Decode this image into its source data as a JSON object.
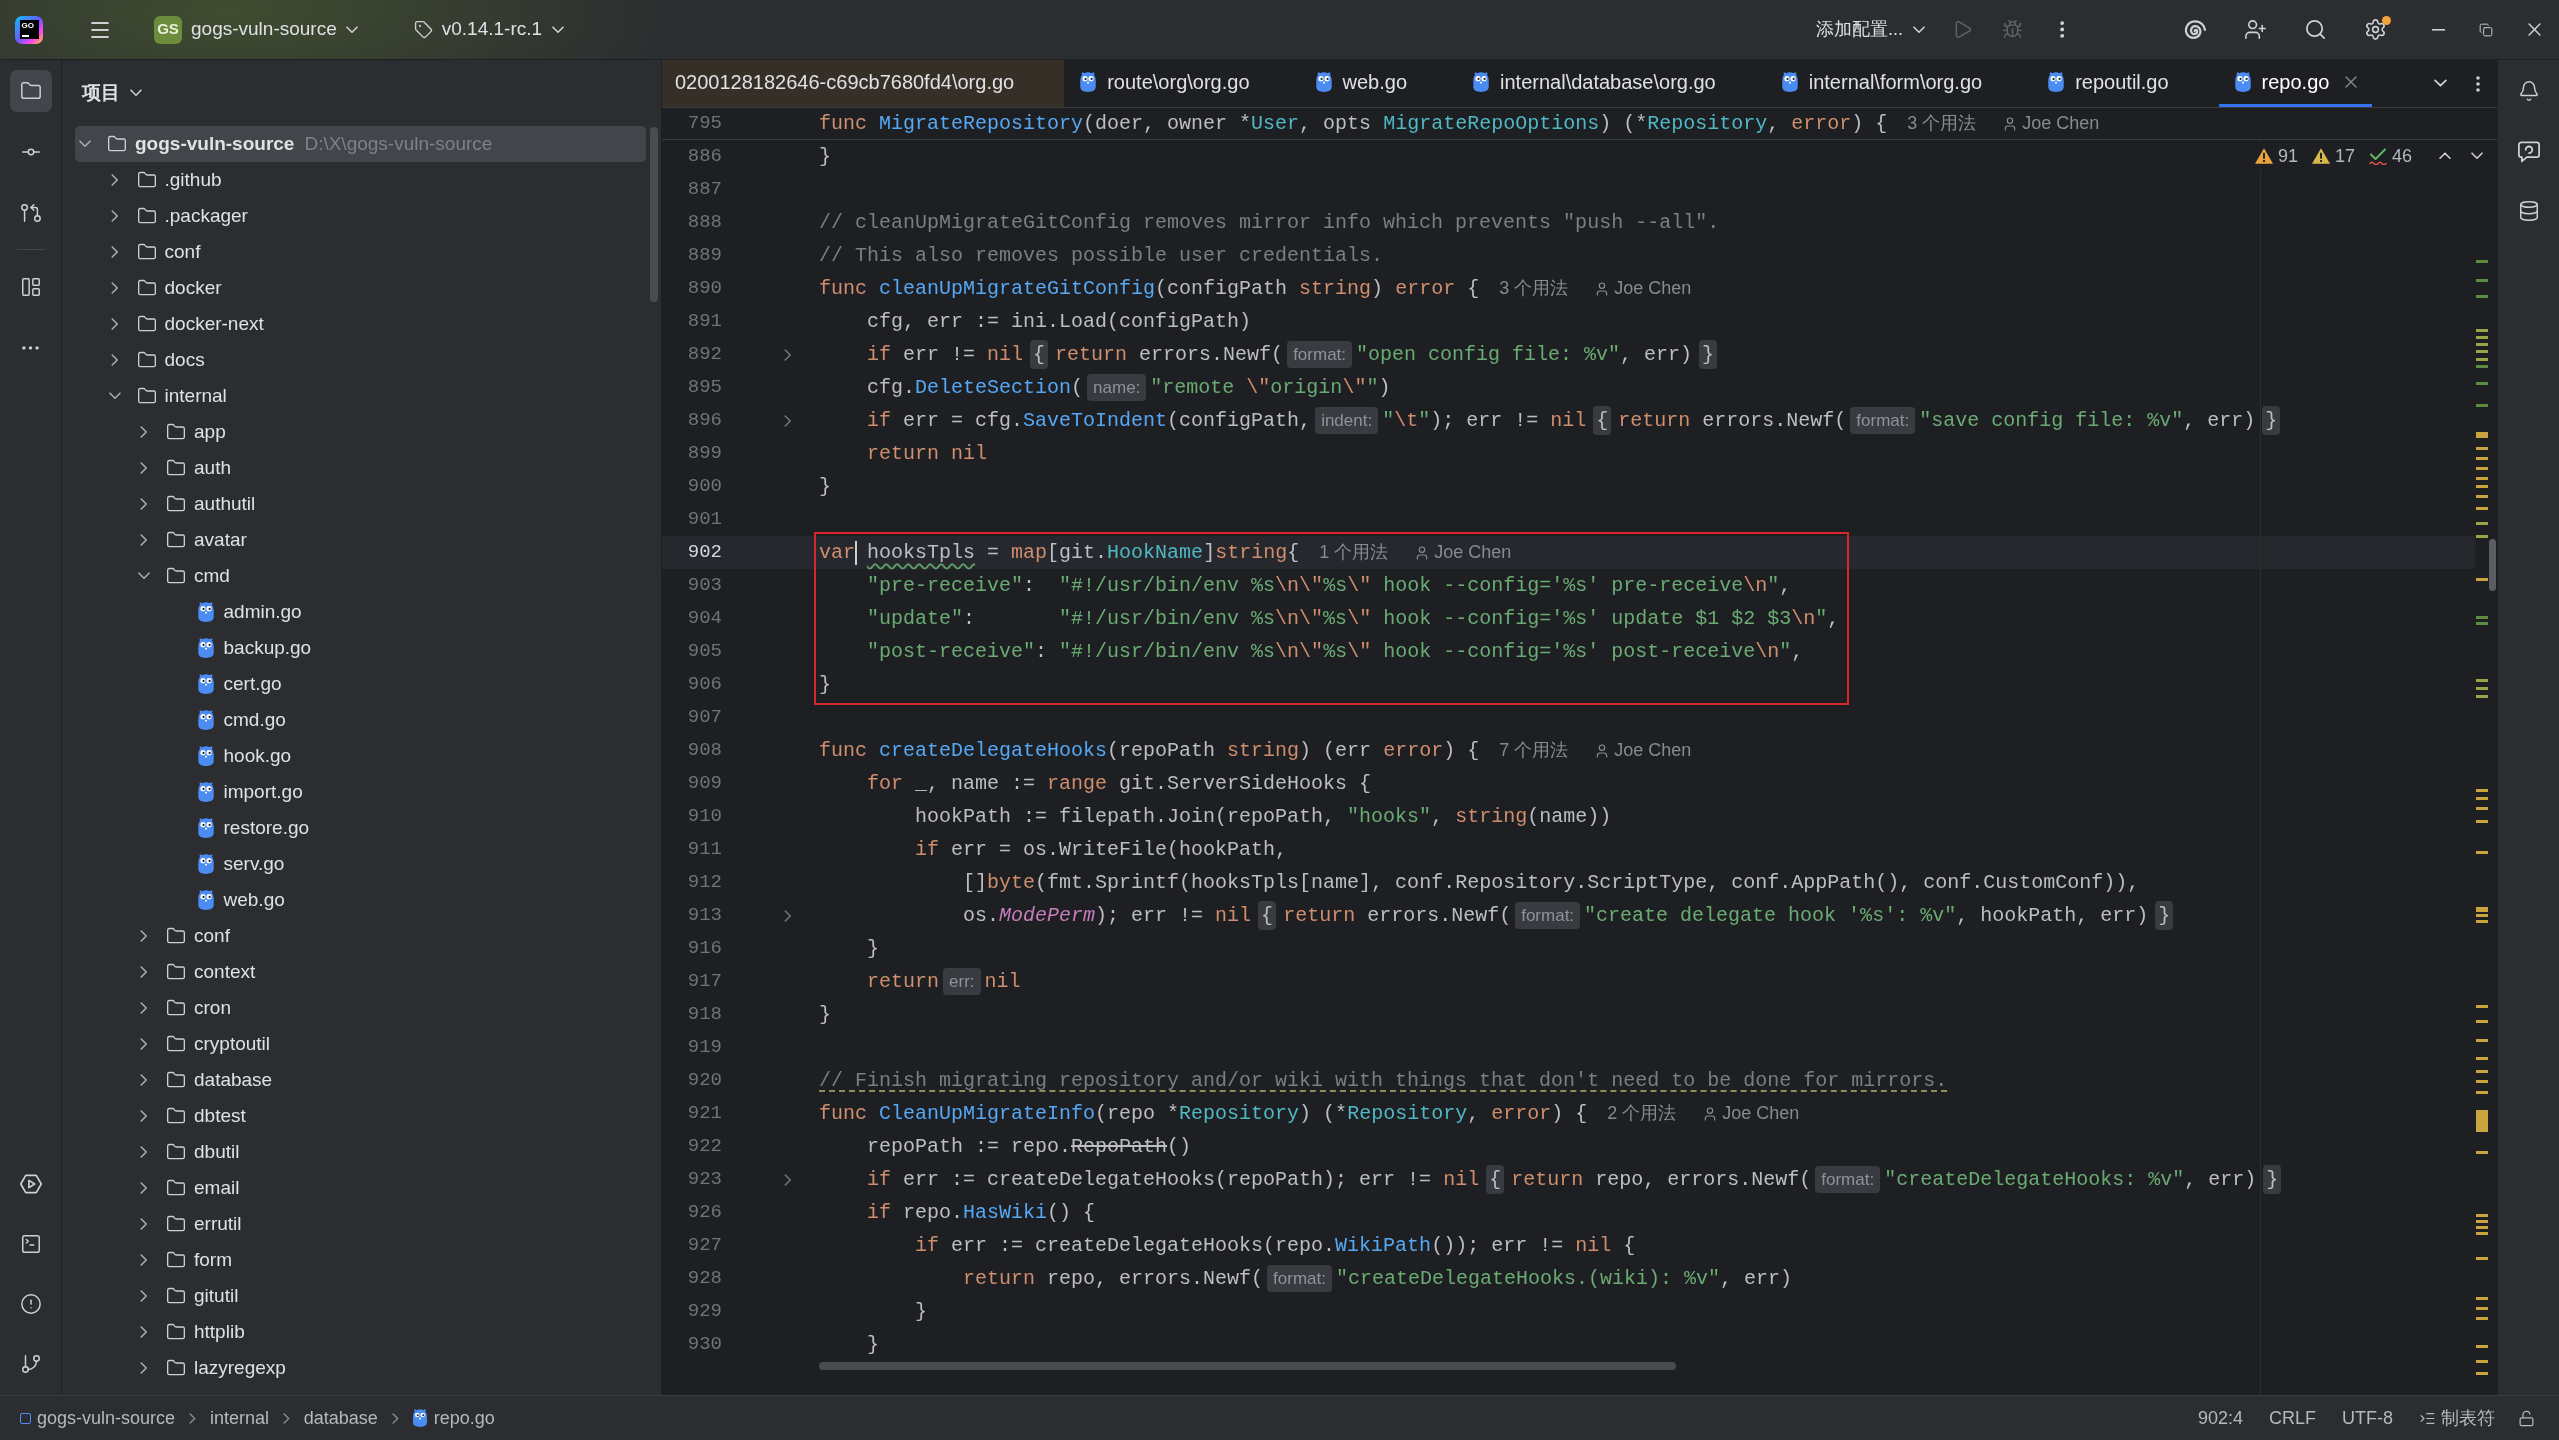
{
  "title_bar": {
    "logo": "GO",
    "project": {
      "initials": "GS",
      "name": "gogs-vuln-source"
    },
    "branch": "v0.14.1-rc.1",
    "run_configuration": "添加配置...",
    "run_actions": [
      {
        "disabled": true
      },
      {
        "disabled": true
      }
    ],
    "settings_badge": true
  },
  "tool_strip": [
    {
      "selected": true
    },
    {
      "selected": false
    },
    {
      "selected": false
    },
    {
      "selected": false
    }
  ],
  "project_panel": {
    "title": "项目",
    "root": {
      "name": "gogs-vuln-source",
      "path": "D:\\X\\gogs-vuln-source",
      "kind": "folder",
      "expanded": true,
      "selected": true,
      "children": [
        {
          "name": ".github",
          "kind": "folder",
          "expanded": false,
          "selected": false
        },
        {
          "name": ".packager",
          "kind": "folder",
          "expanded": false,
          "selected": false
        },
        {
          "name": "conf",
          "kind": "folder",
          "expanded": false,
          "selected": false
        },
        {
          "name": "docker",
          "kind": "folder",
          "expanded": false,
          "selected": false
        },
        {
          "name": "docker-next",
          "kind": "folder",
          "expanded": false,
          "selected": false
        },
        {
          "name": "docs",
          "kind": "folder",
          "expanded": false,
          "selected": false
        },
        {
          "name": "internal",
          "kind": "folder",
          "expanded": true,
          "selected": false,
          "children": [
            {
              "name": "app",
              "kind": "folder",
              "expanded": false,
              "selected": false
            },
            {
              "name": "auth",
              "kind": "folder",
              "expanded": false,
              "selected": false
            },
            {
              "name": "authutil",
              "kind": "folder",
              "expanded": false,
              "selected": false
            },
            {
              "name": "avatar",
              "kind": "folder",
              "expanded": false,
              "selected": false
            },
            {
              "name": "cmd",
              "kind": "folder",
              "expanded": true,
              "selected": false,
              "children": [
                {
                  "name": "admin.go",
                  "kind": "file",
                  "selected": false
                },
                {
                  "name": "backup.go",
                  "kind": "file",
                  "selected": false
                },
                {
                  "name": "cert.go",
                  "kind": "file",
                  "selected": false
                },
                {
                  "name": "cmd.go",
                  "kind": "file",
                  "selected": false
                },
                {
                  "name": "hook.go",
                  "kind": "file",
                  "selected": false
                },
                {
                  "name": "import.go",
                  "kind": "file",
                  "selected": false
                },
                {
                  "name": "restore.go",
                  "kind": "file",
                  "selected": false
                },
                {
                  "name": "serv.go",
                  "kind": "file",
                  "selected": false
                },
                {
                  "name": "web.go",
                  "kind": "file",
                  "selected": false
                }
              ]
            },
            {
              "name": "conf",
              "kind": "folder",
              "expanded": false,
              "selected": false
            },
            {
              "name": "context",
              "kind": "folder",
              "expanded": false,
              "selected": false
            },
            {
              "name": "cron",
              "kind": "folder",
              "expanded": false,
              "selected": false
            },
            {
              "name": "cryptoutil",
              "kind": "folder",
              "expanded": false,
              "selected": false
            },
            {
              "name": "database",
              "kind": "folder",
              "expanded": false,
              "selected": false
            },
            {
              "name": "dbtest",
              "kind": "folder",
              "expanded": false,
              "selected": false
            },
            {
              "name": "dbutil",
              "kind": "folder",
              "expanded": false,
              "selected": false
            },
            {
              "name": "email",
              "kind": "folder",
              "expanded": false,
              "selected": false
            },
            {
              "name": "errutil",
              "kind": "folder",
              "expanded": false,
              "selected": false
            },
            {
              "name": "form",
              "kind": "folder",
              "expanded": false,
              "selected": false
            },
            {
              "name": "gitutil",
              "kind": "folder",
              "expanded": false,
              "selected": false
            },
            {
              "name": "httplib",
              "kind": "folder",
              "expanded": false,
              "selected": false
            },
            {
              "name": "lazyregexp",
              "kind": "folder",
              "expanded": false,
              "selected": false
            }
          ]
        }
      ]
    }
  },
  "tabs": [
    {
      "label": "0200128182646-c69cb7680fd4\\org.go",
      "selected": false,
      "kind": "library",
      "clipped": true
    },
    {
      "label": "route\\org\\org.go",
      "selected": false,
      "kind": "project",
      "clipped": false
    },
    {
      "label": "web.go",
      "selected": false,
      "kind": "project",
      "clipped": false
    },
    {
      "label": "internal\\database\\org.go",
      "selected": false,
      "kind": "project",
      "clipped": false
    },
    {
      "label": "internal\\form\\org.go",
      "selected": false,
      "kind": "project",
      "clipped": false
    },
    {
      "label": "repoutil.go",
      "selected": false,
      "kind": "project",
      "clipped": false
    },
    {
      "label": "repo.go",
      "selected": true,
      "kind": "project",
      "clipped": false
    }
  ],
  "sticky_line": {
    "number": "795",
    "tokens": [
      {
        "kind": "keyword",
        "text": "func "
      },
      {
        "kind": "function",
        "text": "MigrateRepository"
      },
      {
        "kind": "plain",
        "text": "(doer, owner *"
      },
      {
        "kind": "type",
        "text": "User"
      },
      {
        "kind": "plain",
        "text": ", opts "
      },
      {
        "kind": "type",
        "text": "MigrateRepoOptions"
      },
      {
        "kind": "plain",
        "text": ") (*"
      },
      {
        "kind": "type",
        "text": "Repository"
      },
      {
        "kind": "plain",
        "text": ", "
      },
      {
        "kind": "keyword",
        "text": "error"
      },
      {
        "kind": "plain",
        "text": ") {"
      },
      {
        "kind": "usage",
        "text": "3 个用法"
      },
      {
        "kind": "author",
        "text": "Joe Chen"
      }
    ]
  },
  "inspections": [
    {
      "kind": "warning",
      "count": "91"
    },
    {
      "kind": "weak_warning",
      "count": "17"
    },
    {
      "kind": "typo",
      "count": "46"
    }
  ],
  "code_lines": [
    {
      "number": "886",
      "current": false,
      "folded": false,
      "framed": false,
      "tokens": [
        {
          "kind": "plain",
          "text": "}"
        }
      ]
    },
    {
      "number": "887",
      "current": false,
      "folded": false,
      "framed": false
    },
    {
      "number": "888",
      "current": false,
      "folded": false,
      "framed": false,
      "tokens": [
        {
          "kind": "comment",
          "text": "// cleanUpMigrateGitConfig removes mirror info which prevents \"push --all\"."
        }
      ]
    },
    {
      "number": "889",
      "current": false,
      "folded": false,
      "framed": false,
      "tokens": [
        {
          "kind": "comment",
          "text": "// This also removes possible user credentials."
        }
      ]
    },
    {
      "number": "890",
      "current": false,
      "folded": false,
      "framed": false,
      "tokens": [
        {
          "kind": "keyword",
          "text": "func "
        },
        {
          "kind": "function",
          "text": "cleanUpMigrateGitConfig"
        },
        {
          "kind": "plain",
          "text": "(configPath "
        },
        {
          "kind": "keyword",
          "text": "string"
        },
        {
          "kind": "plain",
          "text": ") "
        },
        {
          "kind": "keyword",
          "text": "error"
        },
        {
          "kind": "plain",
          "text": " {"
        },
        {
          "kind": "usage",
          "text": "3 个用法"
        },
        {
          "kind": "author",
          "text": "Joe Chen"
        }
      ]
    },
    {
      "number": "891",
      "current": false,
      "folded": false,
      "framed": false,
      "tokens": [
        {
          "kind": "plain",
          "text": "    cfg, err := ini.Load(configPath)"
        }
      ]
    },
    {
      "number": "892",
      "current": false,
      "folded": true,
      "framed": false,
      "tokens": [
        {
          "kind": "keyword",
          "text": "    if"
        },
        {
          "kind": "plain",
          "text": " err != "
        },
        {
          "kind": "keyword",
          "text": "nil"
        },
        {
          "kind": "fold",
          "text": "{"
        },
        {
          "kind": "keyword",
          "text": "return"
        },
        {
          "kind": "plain",
          "text": " errors.Newf("
        },
        {
          "kind": "hint",
          "text": "format:"
        },
        {
          "kind": "string",
          "text": "\"open config file: %v\""
        },
        {
          "kind": "plain",
          "text": ", err)"
        },
        {
          "kind": "fold",
          "text": "}"
        }
      ]
    },
    {
      "number": "895",
      "current": false,
      "folded": false,
      "framed": false,
      "tokens": [
        {
          "kind": "plain",
          "text": "    cfg."
        },
        {
          "kind": "function",
          "text": "DeleteSection"
        },
        {
          "kind": "plain",
          "text": "("
        },
        {
          "kind": "hint",
          "text": "name:"
        },
        {
          "kind": "string",
          "text": "\"remote "
        },
        {
          "kind": "escape",
          "text": "\\\""
        },
        {
          "kind": "string",
          "text": "origin"
        },
        {
          "kind": "escape",
          "text": "\\\""
        },
        {
          "kind": "string",
          "text": "\""
        },
        {
          "kind": "plain",
          "text": ")"
        }
      ]
    },
    {
      "number": "896",
      "current": false,
      "folded": true,
      "framed": false,
      "tokens": [
        {
          "kind": "keyword",
          "text": "    if"
        },
        {
          "kind": "plain",
          "text": " err = cfg."
        },
        {
          "kind": "function",
          "text": "SaveToIndent"
        },
        {
          "kind": "plain",
          "text": "(configPath,"
        },
        {
          "kind": "hint",
          "text": "indent:"
        },
        {
          "kind": "string",
          "text": "\""
        },
        {
          "kind": "escape",
          "text": "\\t"
        },
        {
          "kind": "string",
          "text": "\""
        },
        {
          "kind": "plain",
          "text": "); err != "
        },
        {
          "kind": "keyword",
          "text": "nil"
        },
        {
          "kind": "fold",
          "text": "{"
        },
        {
          "kind": "keyword",
          "text": "return"
        },
        {
          "kind": "plain",
          "text": " errors.Newf("
        },
        {
          "kind": "hint",
          "text": "format:"
        },
        {
          "kind": "string",
          "text": "\"save config file: %v\""
        },
        {
          "kind": "plain",
          "text": ", err)"
        },
        {
          "kind": "fold",
          "text": "}"
        }
      ]
    },
    {
      "number": "899",
      "current": false,
      "folded": false,
      "framed": false,
      "tokens": [
        {
          "kind": "keyword",
          "text": "    return nil"
        }
      ]
    },
    {
      "number": "900",
      "current": false,
      "folded": false,
      "framed": false,
      "tokens": [
        {
          "kind": "plain",
          "text": "}"
        }
      ]
    },
    {
      "number": "901",
      "current": false,
      "folded": false,
      "framed": false
    },
    {
      "number": "902",
      "current": true,
      "folded": false,
      "framed": true,
      "tokens": [
        {
          "kind": "keyword",
          "text": "var"
        },
        {
          "kind": "caret"
        },
        {
          "kind": "typo",
          "text": " hooksTpls"
        },
        {
          "kind": "plain",
          "text": " = "
        },
        {
          "kind": "keyword",
          "text": "map"
        },
        {
          "kind": "plain",
          "text": "[git."
        },
        {
          "kind": "type",
          "text": "HookName"
        },
        {
          "kind": "plain",
          "text": "]"
        },
        {
          "kind": "keyword",
          "text": "string"
        },
        {
          "kind": "plain",
          "text": "{"
        },
        {
          "kind": "usage",
          "text": "1 个用法"
        },
        {
          "kind": "author",
          "text": "Joe Chen"
        }
      ]
    },
    {
      "number": "903",
      "current": false,
      "folded": false,
      "framed": true,
      "tokens": [
        {
          "kind": "string",
          "text": "    \"pre-receive\""
        },
        {
          "kind": "plain",
          "text": ":  "
        },
        {
          "kind": "string",
          "text": "\"#!/usr/bin/env %s"
        },
        {
          "kind": "escape",
          "text": "\\n\\\""
        },
        {
          "kind": "string",
          "text": "%s"
        },
        {
          "kind": "escape",
          "text": "\\\""
        },
        {
          "kind": "string",
          "text": " hook --config='%s' pre-receive"
        },
        {
          "kind": "escape",
          "text": "\\n"
        },
        {
          "kind": "string",
          "text": "\""
        },
        {
          "kind": "plain",
          "text": ","
        }
      ]
    },
    {
      "number": "904",
      "current": false,
      "folded": false,
      "framed": true,
      "tokens": [
        {
          "kind": "string",
          "text": "    \"update\""
        },
        {
          "kind": "plain",
          "text": ":       "
        },
        {
          "kind": "string",
          "text": "\"#!/usr/bin/env %s"
        },
        {
          "kind": "escape",
          "text": "\\n\\\""
        },
        {
          "kind": "string",
          "text": "%s"
        },
        {
          "kind": "escape",
          "text": "\\\""
        },
        {
          "kind": "string",
          "text": " hook --config='%s' update $1 $2 $3"
        },
        {
          "kind": "escape",
          "text": "\\n"
        },
        {
          "kind": "string",
          "text": "\""
        },
        {
          "kind": "plain",
          "text": ","
        }
      ]
    },
    {
      "number": "905",
      "current": false,
      "folded": false,
      "framed": true,
      "tokens": [
        {
          "kind": "string",
          "text": "    \"post-receive\""
        },
        {
          "kind": "plain",
          "text": ": "
        },
        {
          "kind": "string",
          "text": "\"#!/usr/bin/env %s"
        },
        {
          "kind": "escape",
          "text": "\\n\\\""
        },
        {
          "kind": "string",
          "text": "%s"
        },
        {
          "kind": "escape",
          "text": "\\\""
        },
        {
          "kind": "string",
          "text": " hook --config='%s' post-receive"
        },
        {
          "kind": "escape",
          "text": "\\n"
        },
        {
          "kind": "string",
          "text": "\""
        },
        {
          "kind": "plain",
          "text": ","
        }
      ]
    },
    {
      "number": "906",
      "current": false,
      "folded": false,
      "framed": true,
      "tokens": [
        {
          "kind": "plain",
          "text": "}"
        }
      ]
    },
    {
      "number": "907",
      "current": false,
      "folded": false,
      "framed": false
    },
    {
      "number": "908",
      "current": false,
      "folded": false,
      "framed": false,
      "tokens": [
        {
          "kind": "keyword",
          "text": "func "
        },
        {
          "kind": "function",
          "text": "createDelegateHooks"
        },
        {
          "kind": "plain",
          "text": "(repoPath "
        },
        {
          "kind": "keyword",
          "text": "string"
        },
        {
          "kind": "plain",
          "text": ") (err "
        },
        {
          "kind": "keyword",
          "text": "error"
        },
        {
          "kind": "plain",
          "text": ") {"
        },
        {
          "kind": "usage",
          "text": "7 个用法"
        },
        {
          "kind": "author",
          "text": "Joe Chen"
        }
      ]
    },
    {
      "number": "909",
      "current": false,
      "folded": false,
      "framed": false,
      "tokens": [
        {
          "kind": "keyword",
          "text": "    for"
        },
        {
          "kind": "plain",
          "text": " _, name := "
        },
        {
          "kind": "keyword",
          "text": "range"
        },
        {
          "kind": "plain",
          "text": " git.ServerSideHooks {"
        }
      ]
    },
    {
      "number": "910",
      "current": false,
      "folded": false,
      "framed": false,
      "tokens": [
        {
          "kind": "plain",
          "text": "        hookPath := filepath.Join(repoPath, "
        },
        {
          "kind": "string",
          "text": "\"hooks\""
        },
        {
          "kind": "plain",
          "text": ", "
        },
        {
          "kind": "keyword",
          "text": "string"
        },
        {
          "kind": "plain",
          "text": "(name))"
        }
      ]
    },
    {
      "number": "911",
      "current": false,
      "folded": false,
      "framed": false,
      "tokens": [
        {
          "kind": "keyword",
          "text": "        if"
        },
        {
          "kind": "plain",
          "text": " err = os.WriteFile(hookPath,"
        }
      ]
    },
    {
      "number": "912",
      "current": false,
      "folded": false,
      "framed": false,
      "tokens": [
        {
          "kind": "plain",
          "text": "            []"
        },
        {
          "kind": "keyword",
          "text": "byte"
        },
        {
          "kind": "plain",
          "text": "(fmt.Sprintf(hooksTpls[name], conf.Repository.ScriptType, conf.AppPath(), conf.CustomConf)),"
        }
      ]
    },
    {
      "number": "913",
      "current": false,
      "folded": true,
      "framed": false,
      "tokens": [
        {
          "kind": "plain",
          "text": "            os."
        },
        {
          "kind": "constant",
          "text": "ModePerm"
        },
        {
          "kind": "plain",
          "text": "); err != "
        },
        {
          "kind": "keyword",
          "text": "nil"
        },
        {
          "kind": "fold",
          "text": "{"
        },
        {
          "kind": "keyword",
          "text": "return"
        },
        {
          "kind": "plain",
          "text": " errors.Newf("
        },
        {
          "kind": "hint",
          "text": "format:"
        },
        {
          "kind": "string",
          "text": "\"create delegate hook '%s': %v\""
        },
        {
          "kind": "plain",
          "text": ", hookPath, err)"
        },
        {
          "kind": "fold",
          "text": "}"
        }
      ]
    },
    {
      "number": "916",
      "current": false,
      "folded": false,
      "framed": false,
      "tokens": [
        {
          "kind": "plain",
          "text": "    }"
        }
      ]
    },
    {
      "number": "917",
      "current": false,
      "folded": false,
      "framed": false,
      "tokens": [
        {
          "kind": "keyword",
          "text": "    return"
        },
        {
          "kind": "hint",
          "text": "err:"
        },
        {
          "kind": "keyword",
          "text": "nil"
        }
      ]
    },
    {
      "number": "918",
      "current": false,
      "folded": false,
      "framed": false,
      "tokens": [
        {
          "kind": "plain",
          "text": "}"
        }
      ]
    },
    {
      "number": "919",
      "current": false,
      "folded": false,
      "framed": false
    },
    {
      "number": "920",
      "current": false,
      "folded": false,
      "framed": false,
      "tokens": [
        {
          "kind": "comment_flagged",
          "text": "// Finish migrating repository and/or wiki with things that don't need to be done for mirrors."
        }
      ]
    },
    {
      "number": "921",
      "current": false,
      "folded": false,
      "framed": false,
      "tokens": [
        {
          "kind": "keyword",
          "text": "func "
        },
        {
          "kind": "function",
          "text": "CleanUpMigrateInfo"
        },
        {
          "kind": "plain",
          "text": "(repo *"
        },
        {
          "kind": "type",
          "text": "Repository"
        },
        {
          "kind": "plain",
          "text": ") (*"
        },
        {
          "kind": "type",
          "text": "Repository"
        },
        {
          "kind": "plain",
          "text": ", "
        },
        {
          "kind": "keyword",
          "text": "error"
        },
        {
          "kind": "plain",
          "text": ") {"
        },
        {
          "kind": "usage",
          "text": "2 个用法"
        },
        {
          "kind": "author",
          "text": "Joe Chen"
        }
      ]
    },
    {
      "number": "922",
      "current": false,
      "folded": false,
      "framed": false,
      "tokens": [
        {
          "kind": "plain",
          "text": "    repoPath := repo."
        },
        {
          "kind": "deprecated",
          "text": "RepoPath"
        },
        {
          "kind": "plain",
          "text": "()"
        }
      ]
    },
    {
      "number": "923",
      "current": false,
      "folded": true,
      "framed": false,
      "tokens": [
        {
          "kind": "keyword",
          "text": "    if"
        },
        {
          "kind": "plain",
          "text": " err := createDelegateHooks(repoPath); err != "
        },
        {
          "kind": "keyword",
          "text": "nil"
        },
        {
          "kind": "fold",
          "text": "{"
        },
        {
          "kind": "keyword",
          "text": "return"
        },
        {
          "kind": "plain",
          "text": " repo, errors.Newf("
        },
        {
          "kind": "hint",
          "text": "format:"
        },
        {
          "kind": "string",
          "text": "\"createDelegateHooks: %v\""
        },
        {
          "kind": "plain",
          "text": ", err)"
        },
        {
          "kind": "fold",
          "text": "}"
        }
      ]
    },
    {
      "number": "926",
      "current": false,
      "folded": false,
      "framed": false,
      "tokens": [
        {
          "kind": "keyword",
          "text": "    if"
        },
        {
          "kind": "plain",
          "text": " repo."
        },
        {
          "kind": "function",
          "text": "HasWiki"
        },
        {
          "kind": "plain",
          "text": "() {"
        }
      ]
    },
    {
      "number": "927",
      "current": false,
      "folded": false,
      "framed": false,
      "tokens": [
        {
          "kind": "keyword",
          "text": "        if"
        },
        {
          "kind": "plain",
          "text": " err := createDelegateHooks(repo."
        },
        {
          "kind": "function",
          "text": "WikiPath"
        },
        {
          "kind": "plain",
          "text": "()); err != "
        },
        {
          "kind": "keyword",
          "text": "nil"
        },
        {
          "kind": "plain",
          "text": " {"
        }
      ]
    },
    {
      "number": "928",
      "current": false,
      "folded": false,
      "framed": false,
      "tokens": [
        {
          "kind": "keyword",
          "text": "            return"
        },
        {
          "kind": "plain",
          "text": " repo, errors.Newf("
        },
        {
          "kind": "hint",
          "text": "format:"
        },
        {
          "kind": "string",
          "text": "\"createDelegateHooks.(wiki): %v\""
        },
        {
          "kind": "plain",
          "text": ", err)"
        }
      ]
    },
    {
      "number": "929",
      "current": false,
      "folded": false,
      "framed": false,
      "tokens": [
        {
          "kind": "plain",
          "text": "        }"
        }
      ]
    },
    {
      "number": "930",
      "current": false,
      "folded": false,
      "framed": false,
      "tokens": [
        {
          "kind": "plain",
          "text": "    }"
        }
      ]
    }
  ],
  "status_bar": {
    "breadcrumbs": [
      {
        "label": "gogs-vuln-source",
        "kind": "module"
      },
      {
        "label": "internal",
        "kind": "folder"
      },
      {
        "label": "database",
        "kind": "folder"
      },
      {
        "label": "repo.go",
        "kind": "file"
      }
    ],
    "position": "902:4",
    "line_separator": "CRLF",
    "encoding": "UTF-8",
    "indent": "制表符"
  }
}
